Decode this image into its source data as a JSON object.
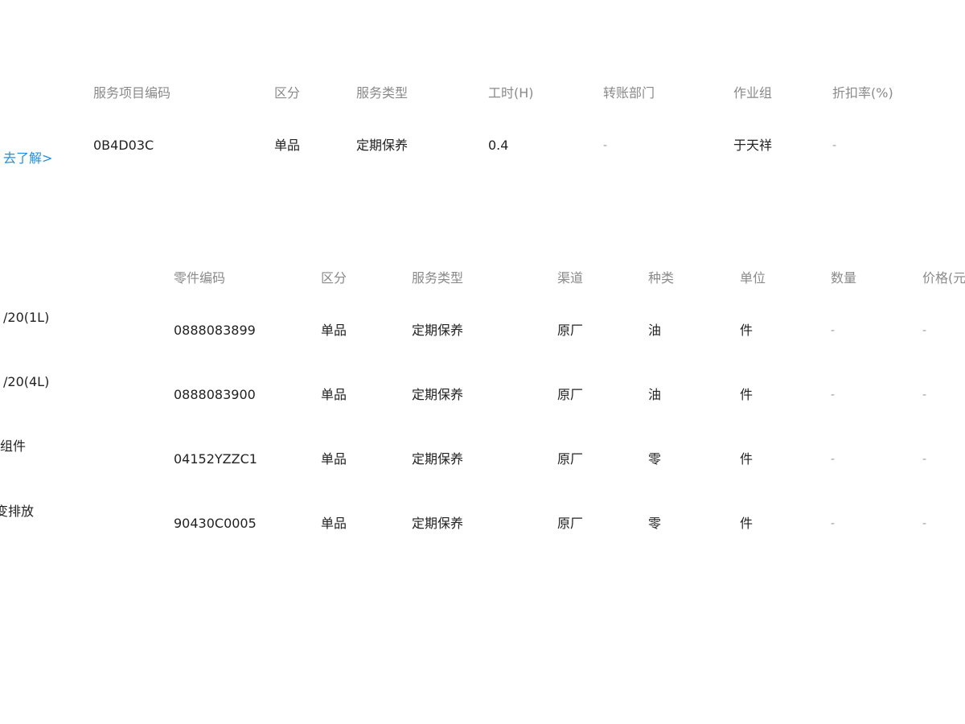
{
  "service_table": {
    "headers": [
      "服务项目编码",
      "区分",
      "服务类型",
      "工时(H)",
      "转账部门",
      "作业组",
      "折扣率(%)"
    ],
    "rows": [
      [
        "0B4D03C",
        "单品",
        "定期保养",
        "0.4",
        "-",
        "于天祥",
        "-"
      ]
    ]
  },
  "learn_more_link": "去了解>",
  "parts_table": {
    "headers": [
      "零件编码",
      "区分",
      "服务类型",
      "渠道",
      "种类",
      "单位",
      "数量",
      "价格(元"
    ],
    "rows": [
      [
        "0888083899",
        "单品",
        "定期保养",
        "原厂",
        "油",
        "件",
        "-",
        "-"
      ],
      [
        "0888083900",
        "单品",
        "定期保养",
        "原厂",
        "油",
        "件",
        "-",
        "-"
      ],
      [
        "04152YZZC1",
        "单品",
        "定期保养",
        "原厂",
        "零",
        "件",
        "-",
        "-"
      ],
      [
        "90430C0005",
        "单品",
        "定期保养",
        "原厂",
        "零",
        "件",
        "-",
        "-"
      ]
    ]
  },
  "left_cut_labels": [
    "/20(1L)",
    "/20(4L)",
    "组件",
    "变排放"
  ]
}
